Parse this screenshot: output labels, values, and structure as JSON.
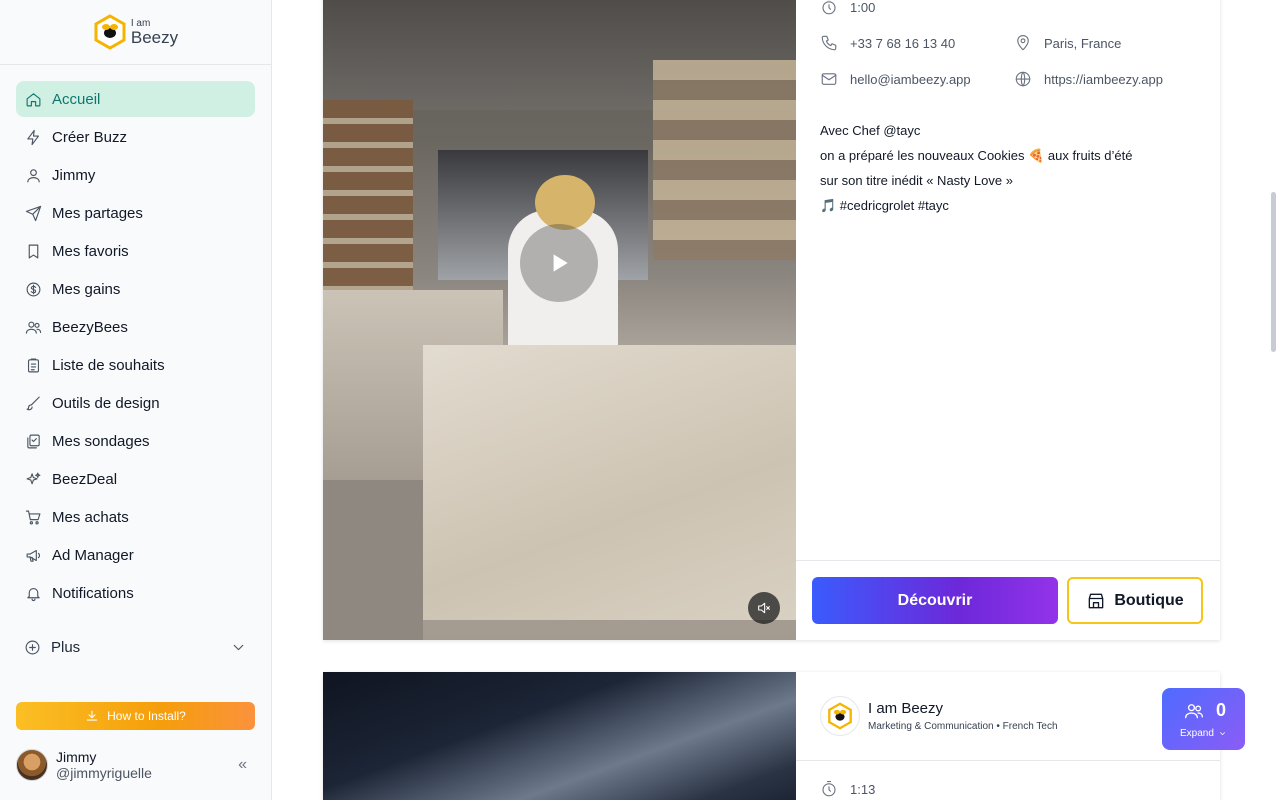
{
  "brand": {
    "small": "I am",
    "big": "Beezy"
  },
  "sidebar": {
    "items": [
      {
        "label": "Accueil",
        "icon": "home-icon",
        "active": true
      },
      {
        "label": "Créer Buzz",
        "icon": "bolt-icon"
      },
      {
        "label": "Jimmy",
        "icon": "user-icon"
      },
      {
        "label": "Mes partages",
        "icon": "send-icon"
      },
      {
        "label": "Mes favoris",
        "icon": "bookmark-icon"
      },
      {
        "label": "Mes gains",
        "icon": "dollar-icon"
      },
      {
        "label": "BeezyBees",
        "icon": "users-icon"
      },
      {
        "label": "Liste de souhaits",
        "icon": "clipboard-icon"
      },
      {
        "label": "Outils de design",
        "icon": "brush-icon"
      },
      {
        "label": "Mes sondages",
        "icon": "poll-icon"
      },
      {
        "label": "BeezDeal",
        "icon": "sparkles-icon"
      },
      {
        "label": "Mes achats",
        "icon": "cart-icon"
      },
      {
        "label": "Ad Manager",
        "icon": "megaphone-icon"
      },
      {
        "label": "Notifications",
        "icon": "bell-icon"
      }
    ],
    "more_label": "Plus",
    "install_label": "How to Install?"
  },
  "user": {
    "name": "Jimmy",
    "handle": "@jimmyriguelle"
  },
  "post1": {
    "duration": "1:00",
    "phone": "+33 7 68 16 13 40",
    "location": "Paris, France",
    "email": "hello@iambeezy.app",
    "website": "https://iambeezy.app",
    "desc": {
      "line1": "Avec Chef @tayc",
      "line2": "on a préparé les nouveaux Cookies 🍕 aux fruits d’été",
      "line3": "sur son titre inédit « Nasty Love »",
      "line4": "🎵 #cedricgrolet #tayc"
    },
    "discover_label": "Découvrir",
    "shop_label": "Boutique"
  },
  "post2": {
    "author_name": "I am Beezy",
    "author_sub": "Marketing & Communication • French Tech",
    "duration": "1:13"
  },
  "widget": {
    "count": "0",
    "expand_label": "Expand"
  },
  "colors": {
    "accent": "#0f766e",
    "active_bg": "#d1f0e4",
    "brand_yellow": "#f5c518",
    "cta_blue": "#3b5bfd",
    "cta_purple": "#9333ea"
  }
}
